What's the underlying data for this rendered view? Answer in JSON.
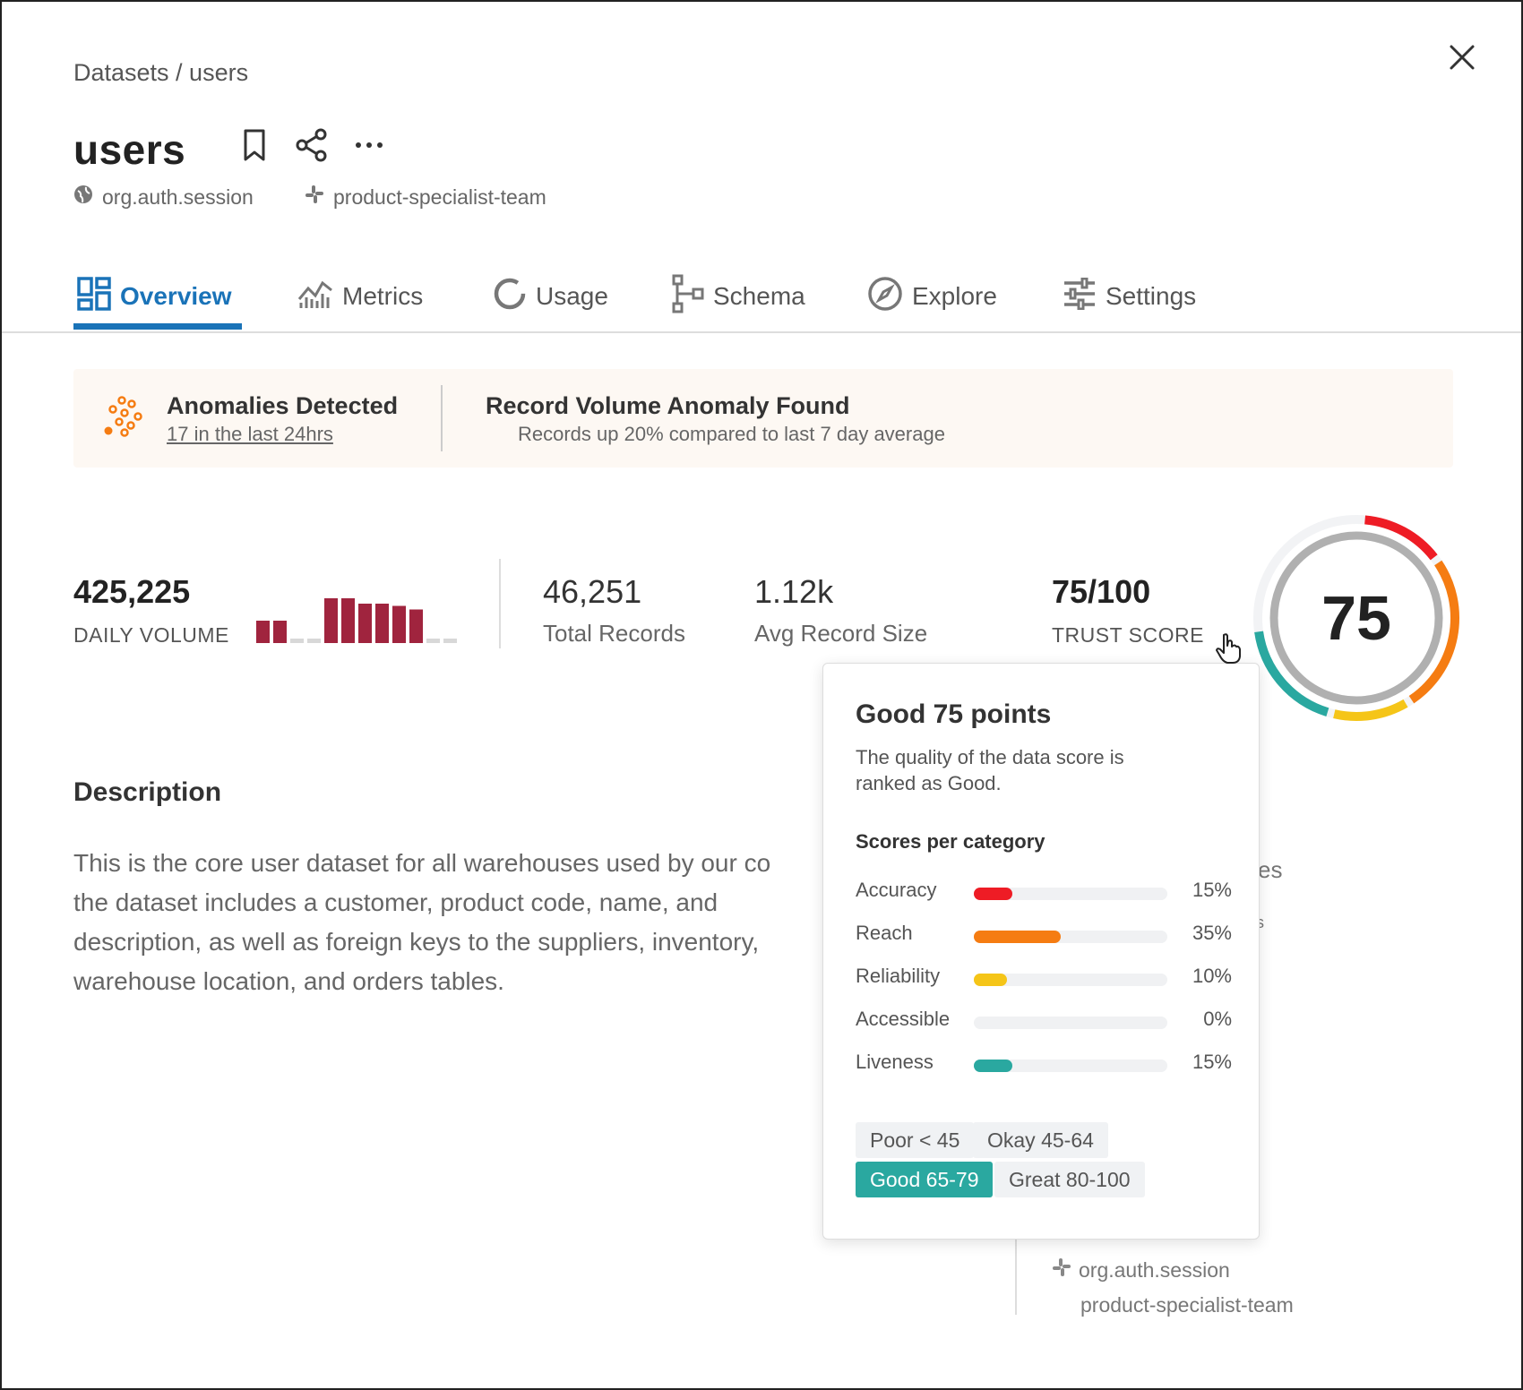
{
  "breadcrumb": "Datasets / users",
  "title": "users",
  "meta": {
    "domain": "org.auth.session",
    "team": "product-specialist-team"
  },
  "tabs": [
    {
      "label": "Overview",
      "active": true
    },
    {
      "label": "Metrics"
    },
    {
      "label": "Usage"
    },
    {
      "label": "Schema"
    },
    {
      "label": "Explore"
    },
    {
      "label": "Settings"
    }
  ],
  "banner": {
    "title": "Anomalies Detected",
    "link": "17 in the last 24hrs",
    "anomaly_title": "Record Volume Anomaly Found",
    "anomaly_desc": "Records up 20% compared to last 7 day average"
  },
  "stats": {
    "daily_volume": "425,225",
    "daily_volume_label": "DAILY VOLUME",
    "total_records": "46,251",
    "total_records_label": "Total Records",
    "avg_size": "1.12k",
    "avg_size_label": "Avg Record Size",
    "trust": "75/100",
    "trust_label": "TRUST SCORE",
    "gauge_value": "75"
  },
  "sparkline": [
    {
      "v": 0.5,
      "c": "#a0243e"
    },
    {
      "v": 0.5,
      "c": "#a0243e"
    },
    {
      "v": 0.1,
      "c": "#d8d8d8"
    },
    {
      "v": 0.1,
      "c": "#d8d8d8"
    },
    {
      "v": 1.0,
      "c": "#a0243e"
    },
    {
      "v": 1.0,
      "c": "#a0243e"
    },
    {
      "v": 0.88,
      "c": "#a0243e"
    },
    {
      "v": 0.88,
      "c": "#a0243e"
    },
    {
      "v": 0.83,
      "c": "#a0243e"
    },
    {
      "v": 0.75,
      "c": "#a0243e"
    },
    {
      "v": 0.1,
      "c": "#d8d8d8"
    },
    {
      "v": 0.1,
      "c": "#d8d8d8"
    }
  ],
  "description": {
    "heading": "Description",
    "text_lines": [
      "This is the core user dataset for all warehouses used by our co",
      "the dataset includes a customer, product code, name, and",
      "description, as well as foreign keys to the suppliers, inventory,",
      "warehouse location, and orders tables."
    ]
  },
  "popover": {
    "title": "Good 75 points",
    "desc": "The quality of the data score is ranked as Good.",
    "subtitle": "Scores per category",
    "categories": [
      {
        "name": "Accuracy",
        "pct": "15%",
        "value": 0.2,
        "color": "#ee1c25"
      },
      {
        "name": "Reach",
        "pct": "35%",
        "value": 0.45,
        "color": "#f57c12"
      },
      {
        "name": "Reliability",
        "pct": "10%",
        "value": 0.17,
        "color": "#f5c518"
      },
      {
        "name": "Accessible",
        "pct": "0%",
        "value": 0,
        "color": "#cccccc"
      },
      {
        "name": "Liveness",
        "pct": "15%",
        "value": 0.2,
        "color": "#2aa8a0"
      }
    ],
    "chips": [
      "Poor < 45",
      "Okay 45-64",
      "Good 65-79",
      "Great 80-100"
    ],
    "selected_chip": "Good 65-79"
  },
  "side_partial": {
    "es": "es",
    "s": "s",
    "domain": "org.auth.session",
    "team": "product-specialist-team"
  },
  "colors": {
    "accent": "#1a73b8",
    "teal": "#2aa8a0",
    "red": "#ee1c25",
    "orange": "#f57c12",
    "yellow": "#f5c518",
    "bar": "#a0243e"
  }
}
